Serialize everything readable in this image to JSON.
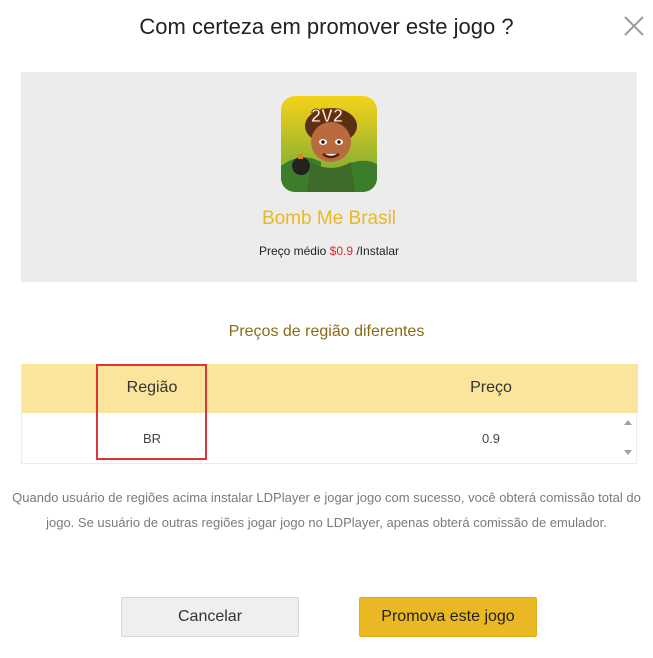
{
  "dialog": {
    "title": "Com certeza em promover este jogo ?",
    "close_icon": "close-icon"
  },
  "game": {
    "name": "Bomb Me Brasil",
    "icon": "game-app-icon",
    "icon_badge": "2V2",
    "price_prefix": "Preço médio ",
    "price_value": "$0.9",
    "price_suffix": " /Instalar"
  },
  "regions": {
    "title": "Preços de região diferentes",
    "columns": [
      "Região",
      "Preço"
    ],
    "rows": [
      {
        "region": "BR",
        "price": "0.9"
      }
    ]
  },
  "note": "Quando usuário de regiões acima instalar LDPlayer e jogar jogo com sucesso, você obterá comissão total do jogo. Se usuário de outras regiões jogar jogo no LDPlayer, apenas obterá comissão de emulador.",
  "buttons": {
    "cancel": "Cancelar",
    "promote": "Promova este jogo"
  },
  "colors": {
    "accent": "#e9b823",
    "table_header": "#fbe49c",
    "price_highlight": "#e0292b",
    "annotation_box": "#d9373a"
  }
}
